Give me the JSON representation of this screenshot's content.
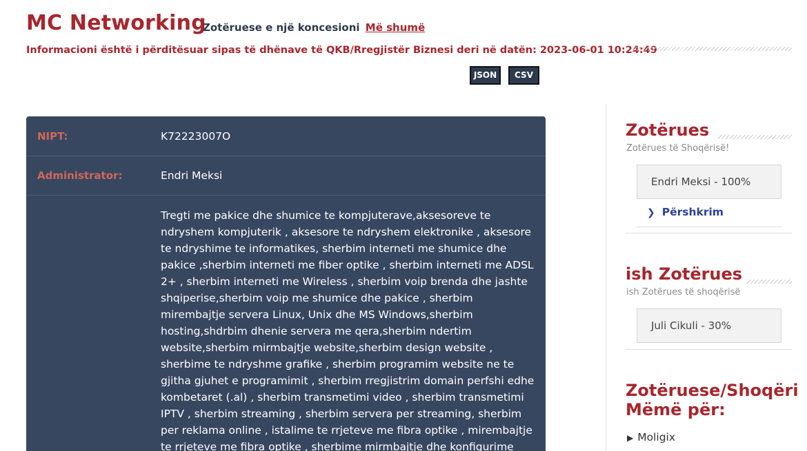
{
  "header": {
    "title": "MC Networking",
    "tagline": "Zotëruese e një koncesioni",
    "more_link": "Më shumë",
    "info": "Informacioni është i përditësuar sipas të dhënave të QKB/Rregjistër Biznesi deri në datën: 2023-06-01 10:24:49",
    "export_json": "JSON",
    "export_csv": "CSV"
  },
  "details": {
    "nipt_label": "NIPT:",
    "nipt_value": "K72223007O",
    "admin_label": "Administrator:",
    "admin_value": "Endri Meksi",
    "description": "Tregti me pakice dhe shumice te kompjuterave,aksesoreve te ndryshem kompjuterik , aksesore te ndryshem elektronike , aksesore te ndryshime te informatikes, sherbim interneti me shumice dhe pakice ,sherbim interneti me fiber optike , sherbim interneti me ADSL 2+ , sherbim interneti me Wireless , sherbim voip brenda dhe jashte shqiperise,sherbim voip me shumice dhe pakice , sherbim mirembajtje servera Linux, Unix dhe MS Windows,sherbim hosting,shdrbim dhenie servera me qera,sherbim ndertim website,sherbim mirmbajtje website,sherbim design website , sherbime te ndryshme grafike , sherbim programim website ne te gjitha gjuhet e programimit , sherbim rregjistrim domain perfshi edhe kombetaret (.al) , sherbim transmetimi video , sherbim transmetimi IPTV , sherbim streaming , sherbim servera per streaming, sherbim per reklama online , istalime te rrjeteve me fibra optike , mirembajtje te rrjeteve me fibra optike , sherbime mirmbajtje dhe konfigurime komplekse te routerave Cisco , Mikrotik , Vyatta ,"
  },
  "sidebar": {
    "owners_title": "Zotërues",
    "owners_sub": "Zotërues të Shoqërisë!",
    "owner_item": "Endri Meksi - 100%",
    "description_link": "Përshkrim",
    "former_title": "ish Zotërues",
    "former_sub": "ish Zotërues të shoqërisë",
    "former_item": "Juli Cikuli - 30%",
    "parent_title_line1": "Zotëruese/Shoqëri",
    "parent_title_line2": "Mëmë për:",
    "parent_item": "Moligix"
  },
  "colors": {
    "brand_red": "#a8262d",
    "panel_bg": "#384760",
    "label_red": "#d0675c",
    "link_blue": "#2c3f9e"
  }
}
